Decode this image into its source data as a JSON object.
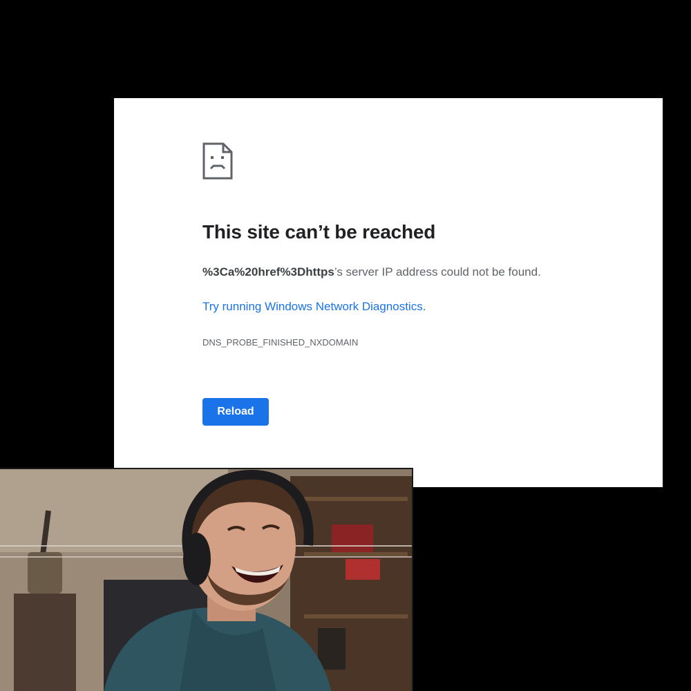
{
  "error_page": {
    "title": "This site can’t be reached",
    "host": "%3Ca%20href%3Dhttps",
    "message_suffix": "’s server IP address could not be found.",
    "diagnostics_link": "Try running Windows Network Diagnostics.",
    "error_code": "DNS_PROBE_FINISHED_NXDOMAIN",
    "reload_label": "Reload",
    "icon": "sad-page-icon"
  },
  "colors": {
    "background": "#000000",
    "panel": "#ffffff",
    "title_text": "#202124",
    "body_text": "#5f6368",
    "link": "#1a73e8",
    "button": "#1a73e8"
  },
  "webcam": {
    "content": "streamer-webcam-photo"
  }
}
